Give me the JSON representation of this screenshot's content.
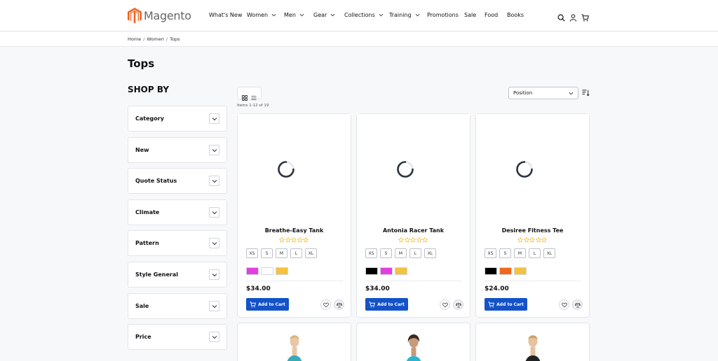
{
  "header": {
    "logo_text": "Magento",
    "brand_color": "#f26322",
    "nav": [
      {
        "label": "What's New",
        "has_menu": false
      },
      {
        "label": "Women",
        "has_menu": true
      },
      {
        "label": "Men",
        "has_menu": true
      },
      {
        "label": "Gear",
        "has_menu": true
      },
      {
        "label": "Collections",
        "has_menu": true
      },
      {
        "label": "Training",
        "has_menu": true
      },
      {
        "label": "Promotions",
        "has_menu": false
      },
      {
        "label": "Sale",
        "has_menu": false
      },
      {
        "label": "Food",
        "has_menu": false
      },
      {
        "label": "Books",
        "has_menu": false
      }
    ],
    "icons": [
      "search-icon",
      "user-icon",
      "cart-icon"
    ]
  },
  "breadcrumb": {
    "items": [
      "Home",
      "Women",
      "Tops"
    ],
    "separator": "/"
  },
  "page": {
    "title": "Tops",
    "shop_by": "SHOP BY"
  },
  "filters": [
    "Category",
    "New",
    "Quote Status",
    "Climate",
    "Pattern",
    "Style General",
    "Sale",
    "Price"
  ],
  "toolbar": {
    "items_count": "Items 1-12 of 19",
    "sort_label": "Position",
    "view_icons": [
      "grid-view-icon",
      "list-view-icon"
    ]
  },
  "products": [
    {
      "name": "Breathe-Easy Tank",
      "price": "$34.00",
      "sizes": [
        "XS",
        "S",
        "M",
        "L",
        "XL"
      ],
      "colors": [
        "#e53ee0",
        "#ffffff",
        "#f5c23d"
      ],
      "add_label": "Add to Cart",
      "rating": 0
    },
    {
      "name": "Antonia Racer Tank",
      "price": "$34.00",
      "sizes": [
        "XS",
        "S",
        "M",
        "L",
        "XL"
      ],
      "colors": [
        "#000000",
        "#e53ee0",
        "#f5c23d"
      ],
      "add_label": "Add to Cart",
      "rating": 0
    },
    {
      "name": "Desiree Fitness Tee",
      "price": "$24.00",
      "sizes": [
        "XS",
        "S",
        "M",
        "L",
        "XL"
      ],
      "colors": [
        "#000000",
        "#ee6a1a",
        "#f5c23d"
      ],
      "add_label": "Add to Cart",
      "rating": 0
    }
  ],
  "colors": {
    "button": "#1452c8",
    "star": "#f3b71b",
    "spinner": "#2d3440"
  }
}
